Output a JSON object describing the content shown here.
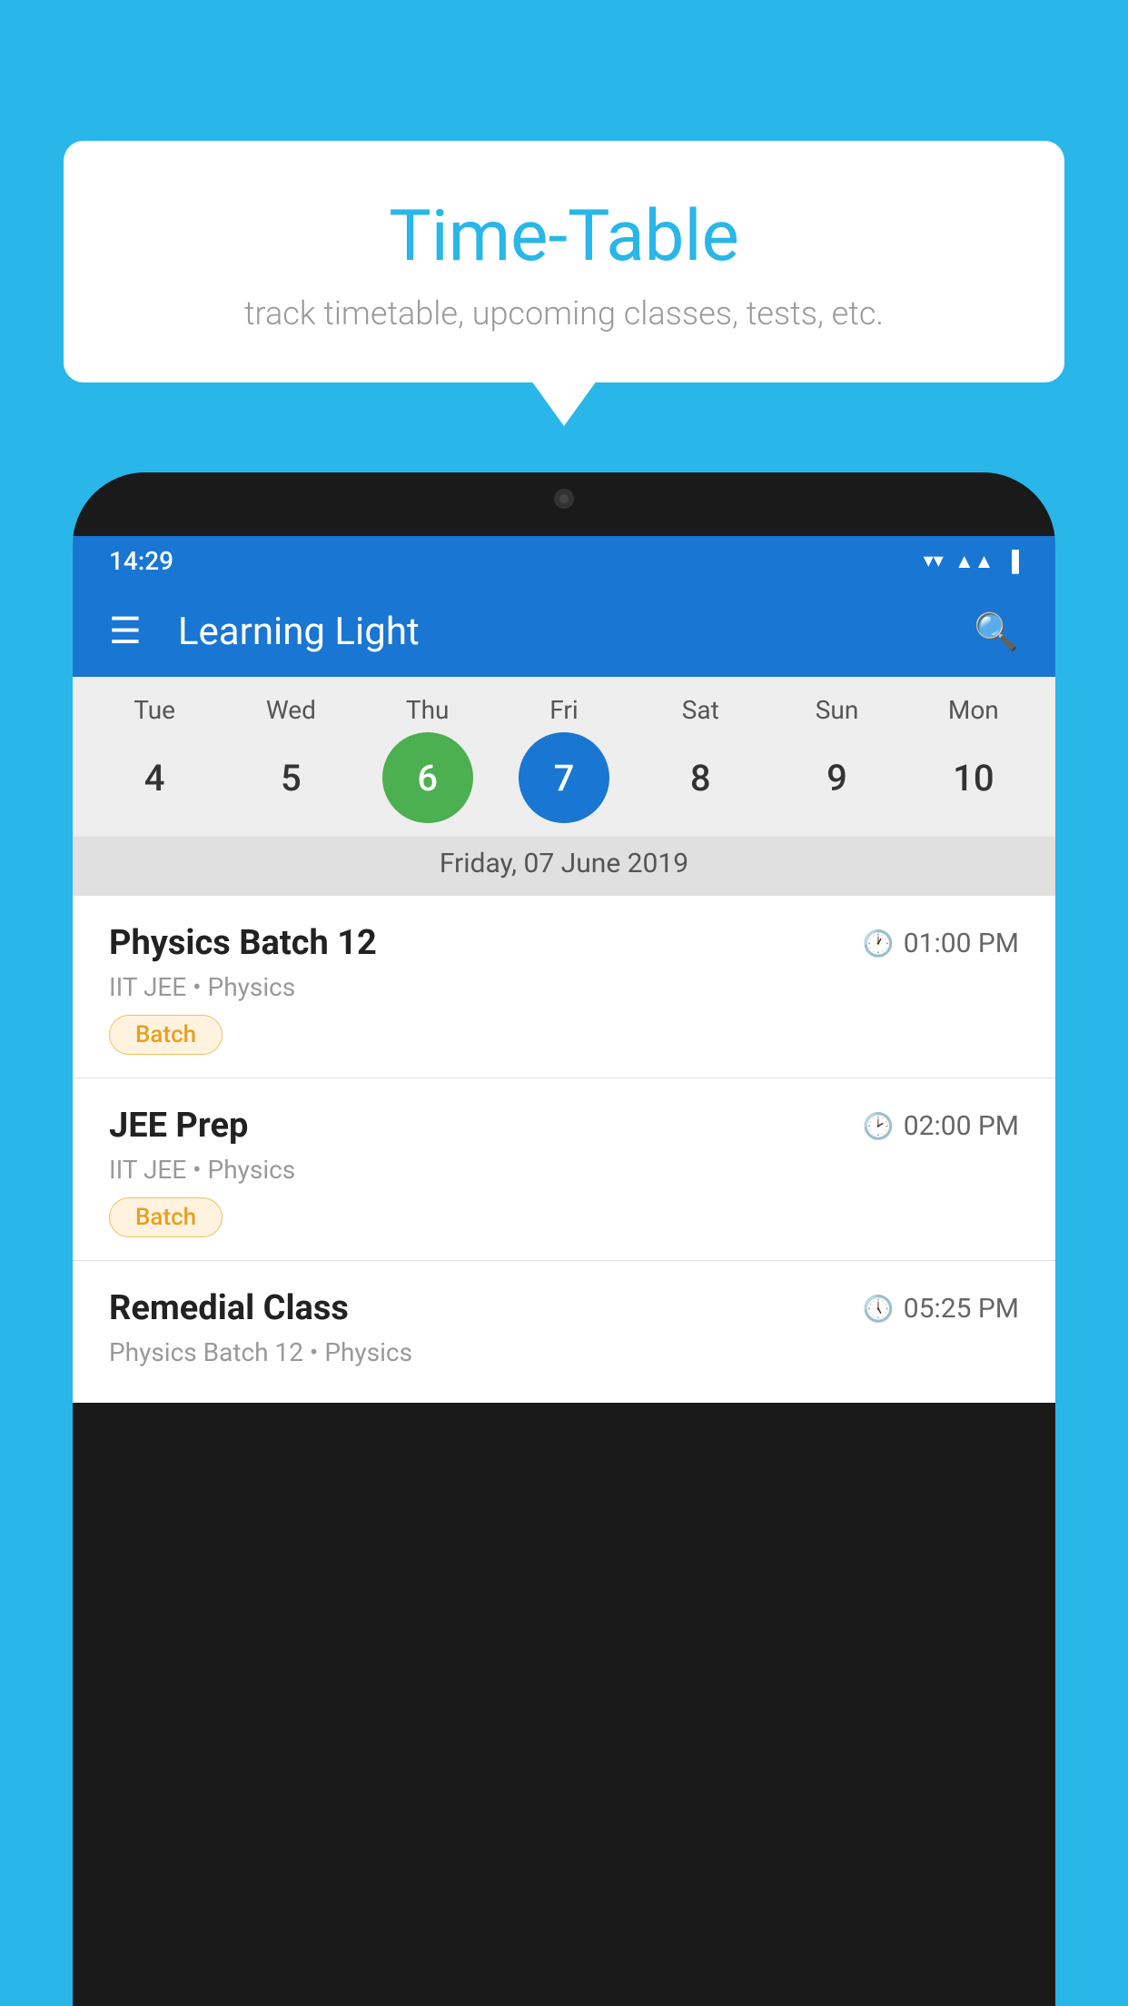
{
  "background_color": "#29b6e8",
  "speech_bubble": {
    "title": "Time-Table",
    "subtitle": "track timetable, upcoming classes, tests, etc."
  },
  "phone": {
    "status_bar": {
      "time": "14:29"
    },
    "app_bar": {
      "title": "Learning Light"
    },
    "calendar": {
      "days": [
        {
          "label": "Tue",
          "number": "4",
          "state": "normal"
        },
        {
          "label": "Wed",
          "number": "5",
          "state": "normal"
        },
        {
          "label": "Thu",
          "number": "6",
          "state": "today"
        },
        {
          "label": "Fri",
          "number": "7",
          "state": "selected"
        },
        {
          "label": "Sat",
          "number": "8",
          "state": "normal"
        },
        {
          "label": "Sun",
          "number": "9",
          "state": "normal"
        },
        {
          "label": "Mon",
          "number": "10",
          "state": "normal"
        }
      ],
      "selected_date_label": "Friday, 07 June 2019"
    },
    "schedule": [
      {
        "title": "Physics Batch 12",
        "time": "01:00 PM",
        "subtitle": "IIT JEE • Physics",
        "badge": "Batch"
      },
      {
        "title": "JEE Prep",
        "time": "02:00 PM",
        "subtitle": "IIT JEE • Physics",
        "badge": "Batch"
      },
      {
        "title": "Remedial Class",
        "time": "05:25 PM",
        "subtitle": "Physics Batch 12 • Physics",
        "badge": null
      }
    ]
  }
}
